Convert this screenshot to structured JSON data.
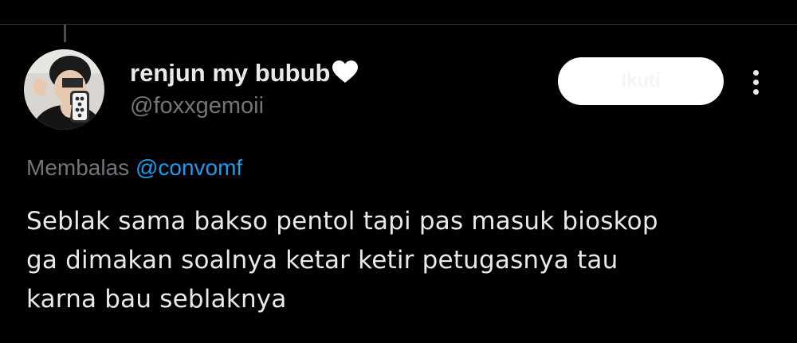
{
  "tweet": {
    "author": {
      "display_name": "renjun my bubub",
      "name_emoji": "white-heart-icon",
      "handle": "@foxxgemoii"
    },
    "follow_button_label": "Ikuti",
    "more_icon": "more-vertical-icon",
    "reply_context": {
      "prefix": "Membalas",
      "mention": "@convomf"
    },
    "text": "Seblak sama bakso pentol tapi pas masuk bioskop\nga dimakan soalnya ketar ketir petugasnya tau\nkarna bau seblaknya"
  },
  "colors": {
    "background": "#000000",
    "primary_text": "#e7e9ea",
    "secondary_text": "#71767b",
    "link": "#1d9bf0",
    "divider": "#2f3336",
    "button_bg": "#ffffff"
  }
}
